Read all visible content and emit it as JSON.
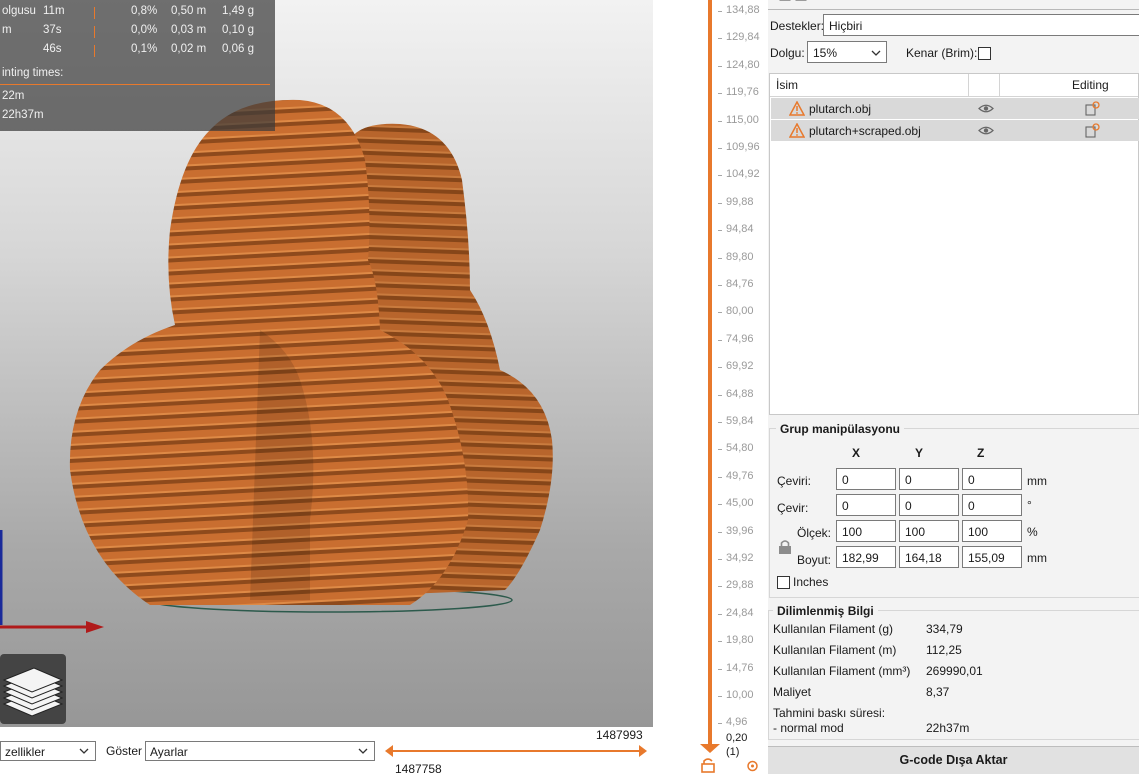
{
  "stats": {
    "rows": [
      {
        "name": "olgusu",
        "time": "11m",
        "pct": "0,8%",
        "len": "0,50 m",
        "wt": "1,49 g"
      },
      {
        "name": "m",
        "time": "37s",
        "pct": "0,0%",
        "len": "0,03 m",
        "wt": "0,10 g"
      },
      {
        "name": "",
        "time": "46s",
        "pct": "0,1%",
        "len": "0,02 m",
        "wt": "0,06 g"
      }
    ],
    "printing_times_label": "inting times:",
    "time1": "22m",
    "time2": "22h37m"
  },
  "bottom_bar": {
    "features_value": "zellikler",
    "show_label": "Göster",
    "show_value": "Ayarlar",
    "h_slider_right": "1487993",
    "h_slider_left": "1487758"
  },
  "layer_slider": {
    "labels": [
      "134,88",
      "129,84",
      "124,80",
      "119,76",
      "115,00",
      "109,96",
      "104,92",
      "99,88",
      "94,84",
      "89,80",
      "84,76",
      "80,00",
      "74,96",
      "69,92",
      "64,88",
      "59,84",
      "54,80",
      "49,76",
      "45,00",
      "39,96",
      "34,92",
      "29,88",
      "24,84",
      "19,80",
      "14,76",
      "10,00",
      "4,96"
    ],
    "bottom_value": "0,20",
    "bottom_index": "(1)"
  },
  "settings": {
    "supports_label": "Destekler:",
    "supports_value": "Hiçbiri",
    "infill_label": "Dolgu:",
    "infill_value": "15%",
    "brim_label": "Kenar (Brim):"
  },
  "object_list": {
    "col_name": "İsim",
    "col_editing": "Editing",
    "items": [
      {
        "name": "plutarch.obj"
      },
      {
        "name": "plutarch+scraped.obj"
      }
    ]
  },
  "manipulation": {
    "title": "Grup manipülasyonu",
    "axis_x": "X",
    "axis_y": "Y",
    "axis_z": "Z",
    "translate_label": "Çeviri:",
    "translate": [
      "0",
      "0",
      "0"
    ],
    "translate_unit": "mm",
    "rotate_label": "Çevir:",
    "rotate": [
      "0",
      "0",
      "0"
    ],
    "rotate_unit": "°",
    "scale_label": "Ölçek:",
    "scale": [
      "100",
      "100",
      "100"
    ],
    "scale_unit": "%",
    "size_label": "Boyut:",
    "size": [
      "182,99",
      "164,18",
      "155,09"
    ],
    "size_unit": "mm",
    "inches_label": "Inches"
  },
  "sliced_info": {
    "title": "Dilimlenmiş Bilgi",
    "rows": [
      {
        "label": "Kullanılan Filament (g)",
        "value": "334,79"
      },
      {
        "label": "Kullanılan Filament (m)",
        "value": "112,25"
      },
      {
        "label": "Kullanılan Filament (mm³)",
        "value": "269990,01"
      },
      {
        "label": "Maliyet",
        "value": "8,37"
      }
    ],
    "estimated_label": "Tahmini baskı süresi:",
    "normal_mode_label": "- normal mod",
    "normal_mode_value": "22h37m"
  },
  "export_button": "G-code Dışa Aktar",
  "colors": {
    "accent": "#e8792c",
    "model": "#c4692c",
    "model_dark": "#8a4418"
  }
}
